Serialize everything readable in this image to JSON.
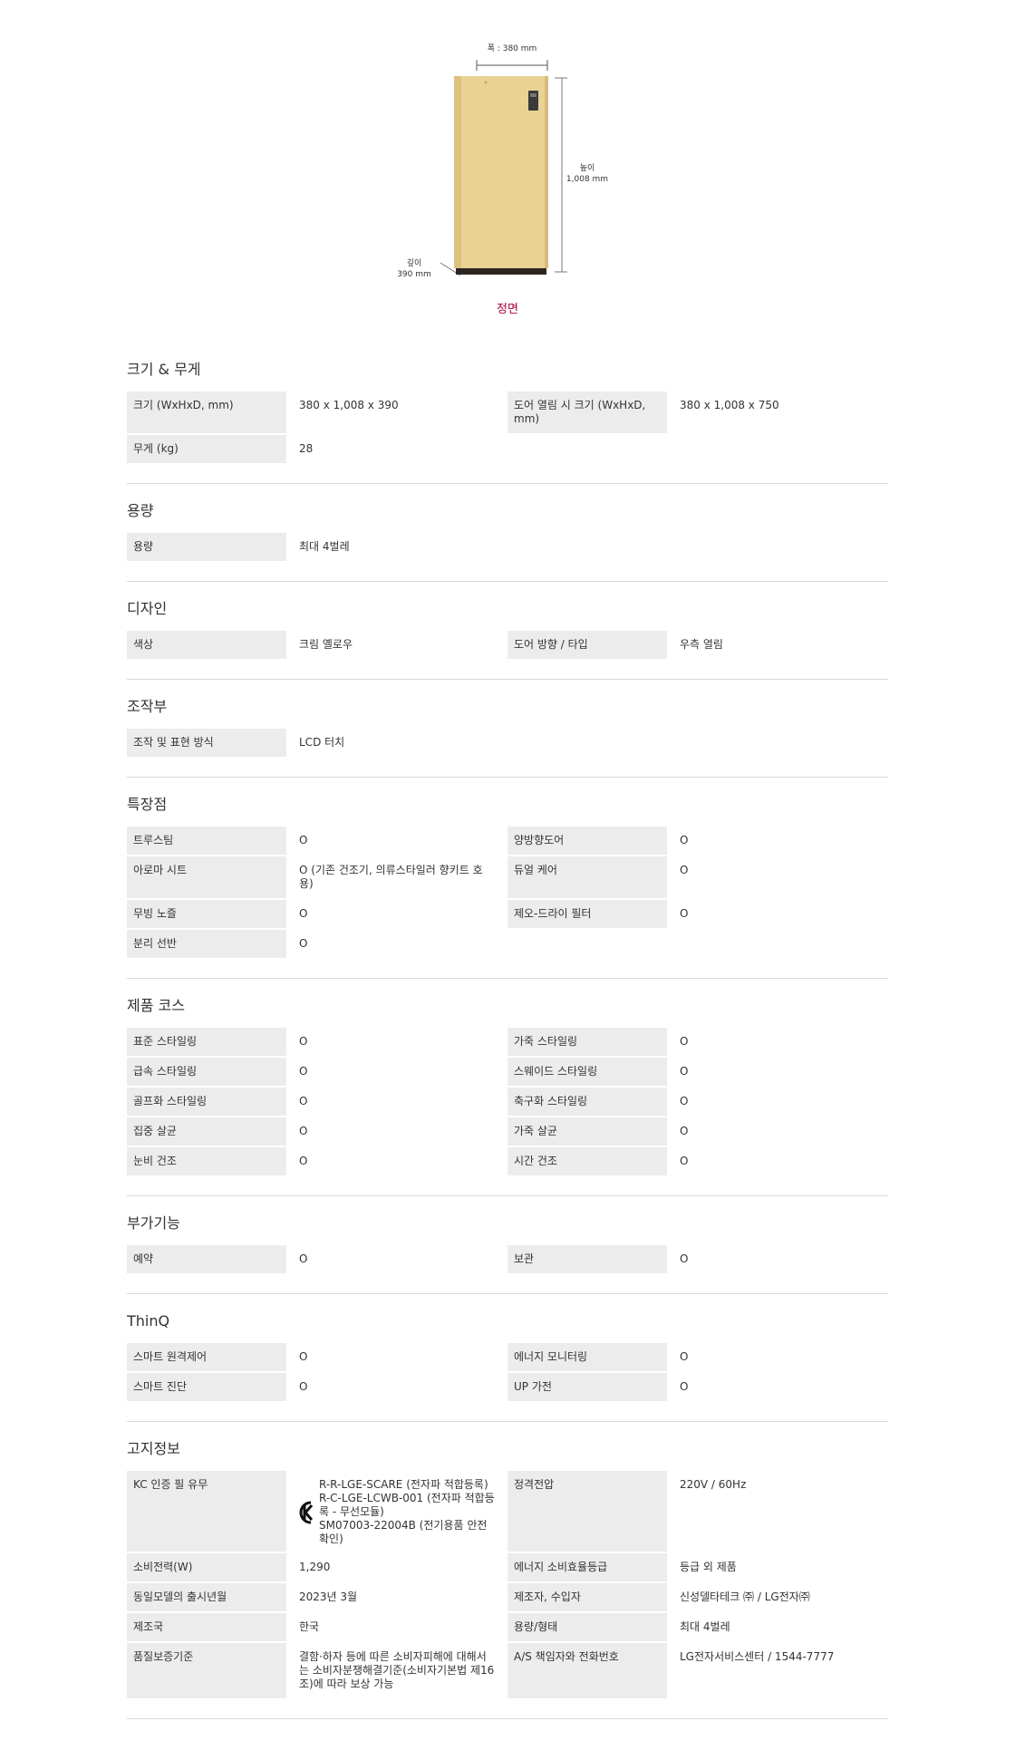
{
  "figure": {
    "width_label": "폭 : 380 mm",
    "height_label": "높이",
    "height_value": "1,008 mm",
    "depth_label": "깊이",
    "depth_value": "390 mm",
    "caption": "정면",
    "product_color": "#e9d294",
    "brand_color": "#a50034"
  },
  "sections": [
    {
      "title": "크기 & 무게",
      "rows": [
        [
          [
            "크기 (WxHxD, mm)",
            "380 x 1,008 x 390"
          ],
          [
            "도어 열림 시 크기 (WxHxD, mm)",
            "380 x 1,008 x 750"
          ]
        ],
        [
          [
            "무게 (kg)",
            "28"
          ]
        ]
      ]
    },
    {
      "title": "용량",
      "rows": [
        [
          [
            "용량",
            "최대 4벌레"
          ]
        ]
      ]
    },
    {
      "title": "디자인",
      "rows": [
        [
          [
            "색상",
            "크림 옐로우"
          ],
          [
            "도어 방향 / 타입",
            "우측 열림"
          ]
        ]
      ]
    },
    {
      "title": "조작부",
      "rows": [
        [
          [
            "조작 및 표현 방식",
            "LCD 터치"
          ]
        ]
      ]
    },
    {
      "title": "특장점",
      "rows": [
        [
          [
            "트루스팀",
            "O"
          ],
          [
            "양방향도어",
            "O"
          ]
        ],
        [
          [
            "아로마 시트",
            "O (기존 건조기, 의류스타일러 향키트 호용)"
          ],
          [
            "듀얼 케어",
            "O"
          ]
        ],
        [
          [
            "무빙 노즐",
            "O"
          ],
          [
            "제오-드라이 필터",
            "O"
          ]
        ],
        [
          [
            "분리 선반",
            "O"
          ]
        ]
      ]
    },
    {
      "title": "제품 코스",
      "rows": [
        [
          [
            "표준 스타일링",
            "O"
          ],
          [
            "가죽 스타일링",
            "O"
          ]
        ],
        [
          [
            "급속 스타일링",
            "O"
          ],
          [
            "스웨이드 스타일링",
            "O"
          ]
        ],
        [
          [
            "골프화 스타일링",
            "O"
          ],
          [
            "축구화 스타일링",
            "O"
          ]
        ],
        [
          [
            "집중 살균",
            "O"
          ],
          [
            "가죽 살균",
            "O"
          ]
        ],
        [
          [
            "눈비 건조",
            "O"
          ],
          [
            "시간 건조",
            "O"
          ]
        ]
      ]
    },
    {
      "title": "부가기능",
      "rows": [
        [
          [
            "예약",
            "O"
          ],
          [
            "보관",
            "O"
          ]
        ]
      ]
    },
    {
      "title": "ThinQ",
      "rows": [
        [
          [
            "스마트 원격제어",
            "O"
          ],
          [
            "에너지 모니터링",
            "O"
          ]
        ],
        [
          [
            "스마트 진단",
            "O"
          ],
          [
            "UP 가전",
            "O"
          ]
        ]
      ]
    },
    {
      "title": "고지정보",
      "rows": [
        [
          [
            "KC 인증 필 유무",
            "R-R-LGE-SCARE (전자파 적합등록)\nR-C-LGE-LCWB-001 (전자파 적합등록 - 무선모듈)\nSM07003-22004B (전기용품 안전확인)",
            "kc"
          ],
          [
            "정격전압",
            "220V / 60Hz"
          ]
        ],
        [
          [
            "소비전력(W)",
            "1,290"
          ],
          [
            "에너지 소비효율등급",
            "등급 외 제품"
          ]
        ],
        [
          [
            "동일모델의 출시년월",
            "2023년 3월"
          ],
          [
            "제조자, 수입자",
            "신성델타테크 ㈜ / LG전자㈜"
          ]
        ],
        [
          [
            "제조국",
            "한국"
          ],
          [
            "용량/형태",
            "최대 4벌레"
          ]
        ],
        [
          [
            "품질보증기준",
            "결함·하자 등에 따른 소비자피해에 대해서는 소비자분쟁해결기준(소비자기본법 제16조)에 따라 보상 가능"
          ],
          [
            "A/S 책임자와 전화번호",
            "LG전자서비스센터 / 1544-7777"
          ]
        ]
      ]
    }
  ]
}
